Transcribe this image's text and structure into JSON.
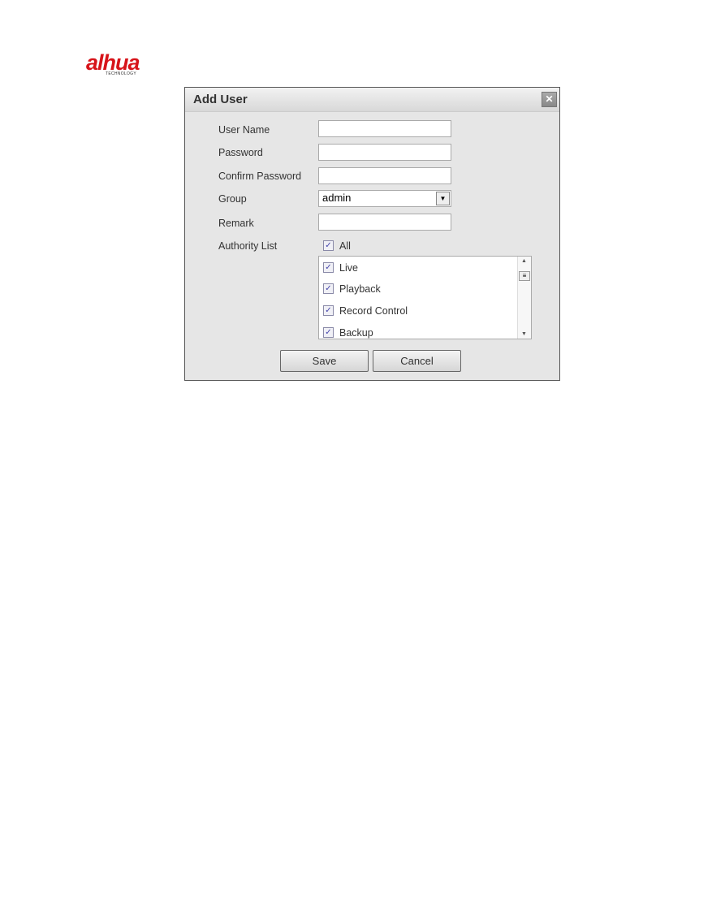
{
  "logo": {
    "brand": "alhua",
    "tagline": "TECHNOLOGY"
  },
  "dialog": {
    "title": "Add User",
    "close_icon": "close-icon",
    "fields": [
      {
        "label": "User Name",
        "value": ""
      },
      {
        "label": "Password",
        "value": ""
      },
      {
        "label": "Confirm Password",
        "value": ""
      },
      {
        "label": "Group",
        "value": "admin"
      },
      {
        "label": "Remark",
        "value": ""
      }
    ],
    "authority_label": "Authority List",
    "all": {
      "label": "All",
      "checked": true
    },
    "authorities": [
      {
        "label": "Live",
        "checked": true
      },
      {
        "label": "Playback",
        "checked": true
      },
      {
        "label": "Record Control",
        "checked": true
      },
      {
        "label": "Backup",
        "checked": true
      }
    ],
    "save_label": "Save",
    "cancel_label": "Cancel"
  }
}
